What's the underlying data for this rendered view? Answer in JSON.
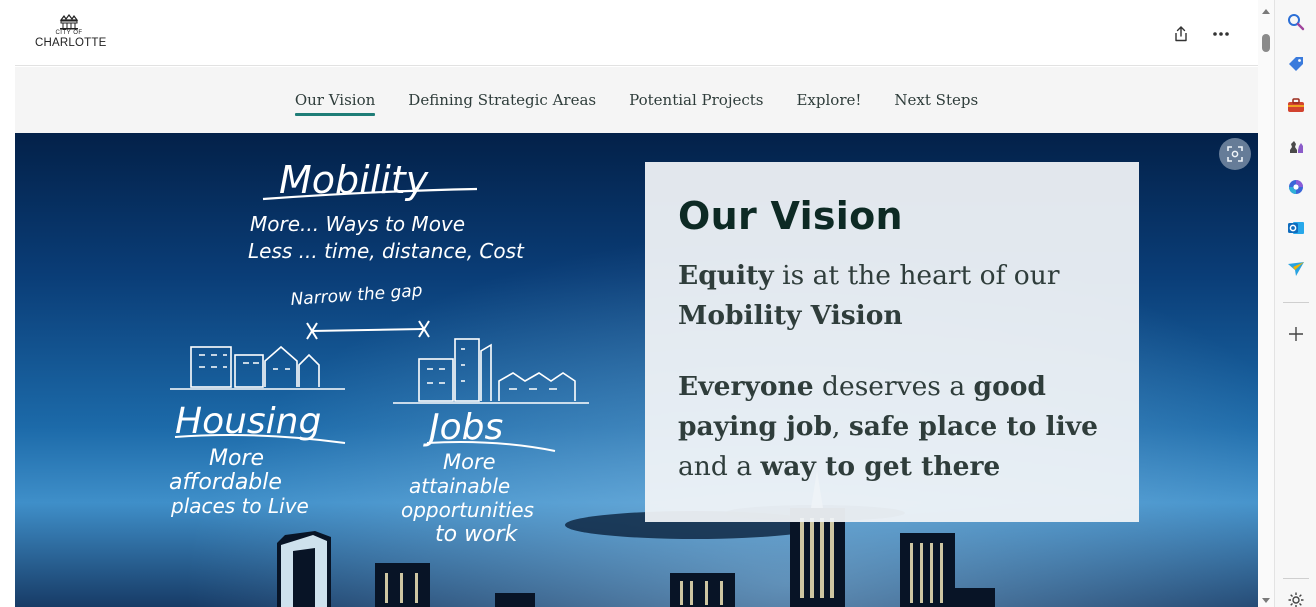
{
  "logo": {
    "city_of": "CITY OF",
    "name": "CHARLOTTE"
  },
  "header": {
    "share_icon": "share-icon",
    "more_icon": "more-icon"
  },
  "nav": {
    "items": [
      {
        "label": "Our Vision",
        "active": true
      },
      {
        "label": "Defining Strategic Areas",
        "active": false
      },
      {
        "label": "Potential Projects",
        "active": false
      },
      {
        "label": "Explore!",
        "active": false
      },
      {
        "label": "Next Steps",
        "active": false
      }
    ]
  },
  "hero": {
    "handwriting": {
      "mobility": "Mobility",
      "mobility_line1": "More... Ways to Move",
      "mobility_line2": "Less ... time, distance, Cost",
      "narrow": "Narrow the gap",
      "housing": "Housing",
      "housing_line1": "More",
      "housing_line2": "affordable",
      "housing_line3": "places to Live",
      "jobs": "Jobs",
      "jobs_line1": "More",
      "jobs_line2": "attainable",
      "jobs_line3": "opportunities",
      "jobs_line4": "to work"
    },
    "card": {
      "title": "Our Vision",
      "p1": {
        "b1": "Equity",
        "t1": " is at the heart of our ",
        "b2": "Mobility Vision"
      },
      "p2": {
        "b1": "Everyone",
        "t1": " deserves a ",
        "b2": "good paying job",
        "t2": ", ",
        "b3": "safe place to live",
        "t3": " and a ",
        "b4": "way to get there"
      }
    }
  },
  "side_panel": {
    "icons": [
      "search-icon",
      "tag-icon",
      "toolbox-icon",
      "chess-icon",
      "copilot-icon",
      "outlook-icon",
      "send-icon",
      "add-icon",
      "settings-icon"
    ]
  },
  "colors": {
    "nav_active_underline": "#1f7d77",
    "title_color": "#0d2a24",
    "text_color": "#2f3d3b",
    "card_bg": "#f0f3f7",
    "hero_top": "#032149"
  }
}
